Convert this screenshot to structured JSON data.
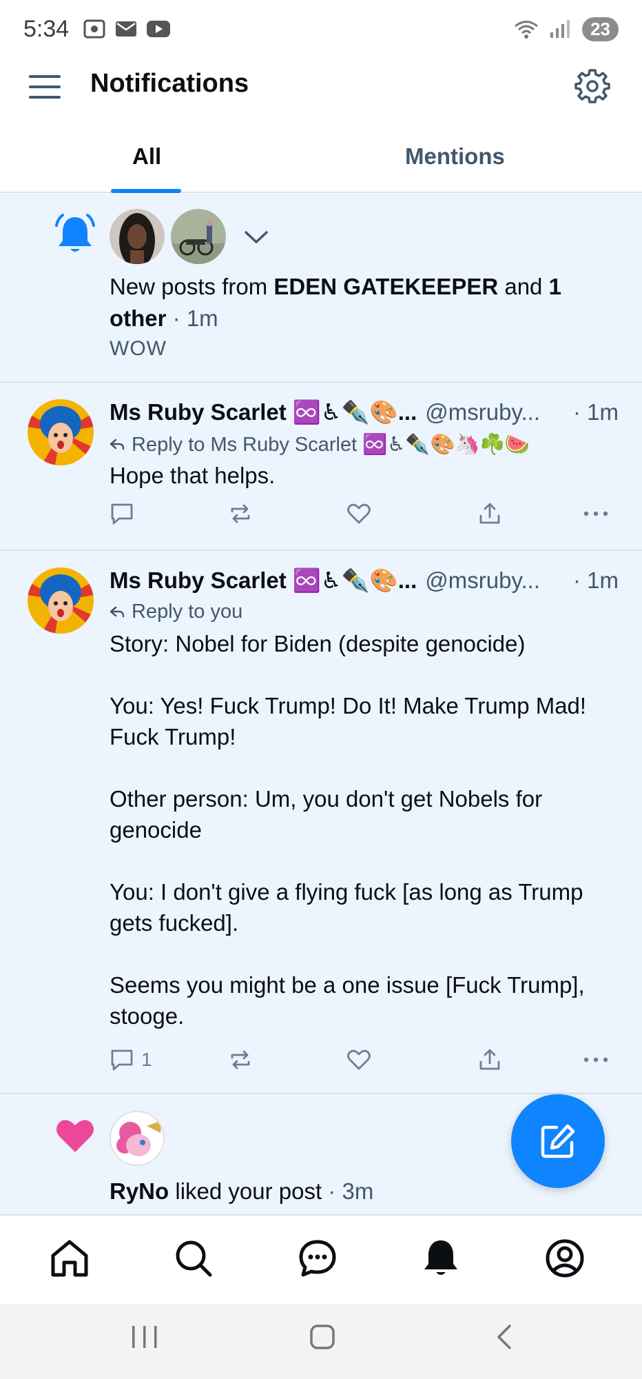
{
  "status_bar": {
    "time": "5:34",
    "battery": "23"
  },
  "header": {
    "title": "Notifications"
  },
  "tabs": [
    {
      "label": "All",
      "selected": true
    },
    {
      "label": "Mentions",
      "selected": false
    }
  ],
  "feed": {
    "new_posts": {
      "prefix": "New posts from ",
      "author": "EDEN GATEKEEPER",
      "middle": " and ",
      "others": "1 other",
      "time": " · 1m",
      "subtext": "WOW"
    },
    "post1": {
      "name": "Ms Ruby Scarlet ♾️♿✒️🎨...",
      "handle": "@msruby...",
      "time": "· 1m",
      "reply_to": "Reply to Ms Ruby Scarlet ♾️♿✒️🎨🦄☘️🍉",
      "body": "Hope that helps."
    },
    "post2": {
      "name": "Ms Ruby Scarlet ♾️♿✒️🎨...",
      "handle": "@msruby...",
      "time": "· 1m",
      "reply_to": "Reply to you",
      "body": "Story: Nobel for Biden (despite genocide)\n\nYou: Yes! Fuck Trump! Do It! Make Trump Mad! Fuck Trump!\n\nOther person: Um, you don't get Nobels for genocide\n\nYou: I don't give a flying fuck [as long as Trump gets fucked].\n\nSeems you might be a one issue [Fuck Trump], stooge.",
      "reply_count": "1"
    },
    "like": {
      "user": "RyNo",
      "text": " liked your post",
      "time": " · 3m"
    }
  },
  "colors": {
    "accent": "#1083fe",
    "muted": "#42576c",
    "feed_bg": "#ecf4fd",
    "like_pink": "#ec4899"
  }
}
